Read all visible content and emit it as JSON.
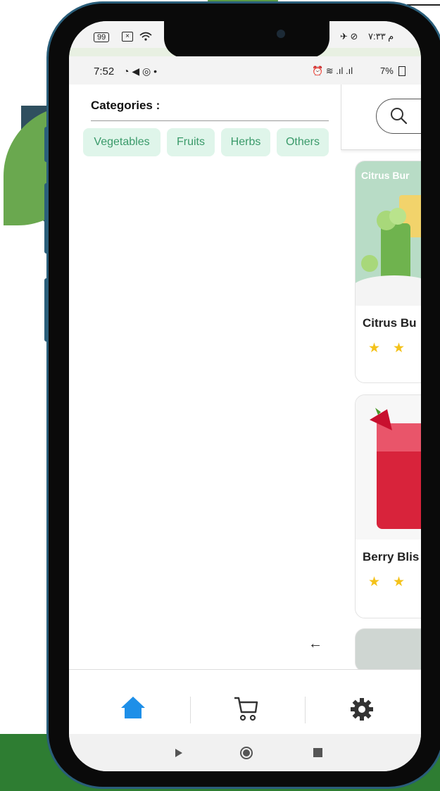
{
  "outer_status": {
    "left_icons": "99",
    "right_text": "ﻡ ٧:٣٣"
  },
  "inner_status": {
    "time": "7:52",
    "right_text": "7%"
  },
  "categories": {
    "title": "Categories :",
    "chips": [
      "Vegetables",
      "Fruits",
      "Herbs",
      "Others"
    ]
  },
  "products": [
    {
      "image_label": "Citrus Bur",
      "name": "Citrus Bu",
      "rating_stars": "★★"
    },
    {
      "name": "Berry Blis",
      "rating_stars": "★★"
    }
  ],
  "back_arrow": "←",
  "nav": {
    "items": [
      "home-icon",
      "cart-icon",
      "settings-icon"
    ],
    "active": "home-icon",
    "accent": "#1e8fe8"
  },
  "sys_nav": {
    "items": [
      "back-icon",
      "home-circle-icon",
      "recents-icon"
    ]
  },
  "colors": {
    "chip_bg": "#dff5ea",
    "chip_text": "#3a9a6a",
    "star": "#f4c21a",
    "brand_green": "#2e7d32"
  }
}
